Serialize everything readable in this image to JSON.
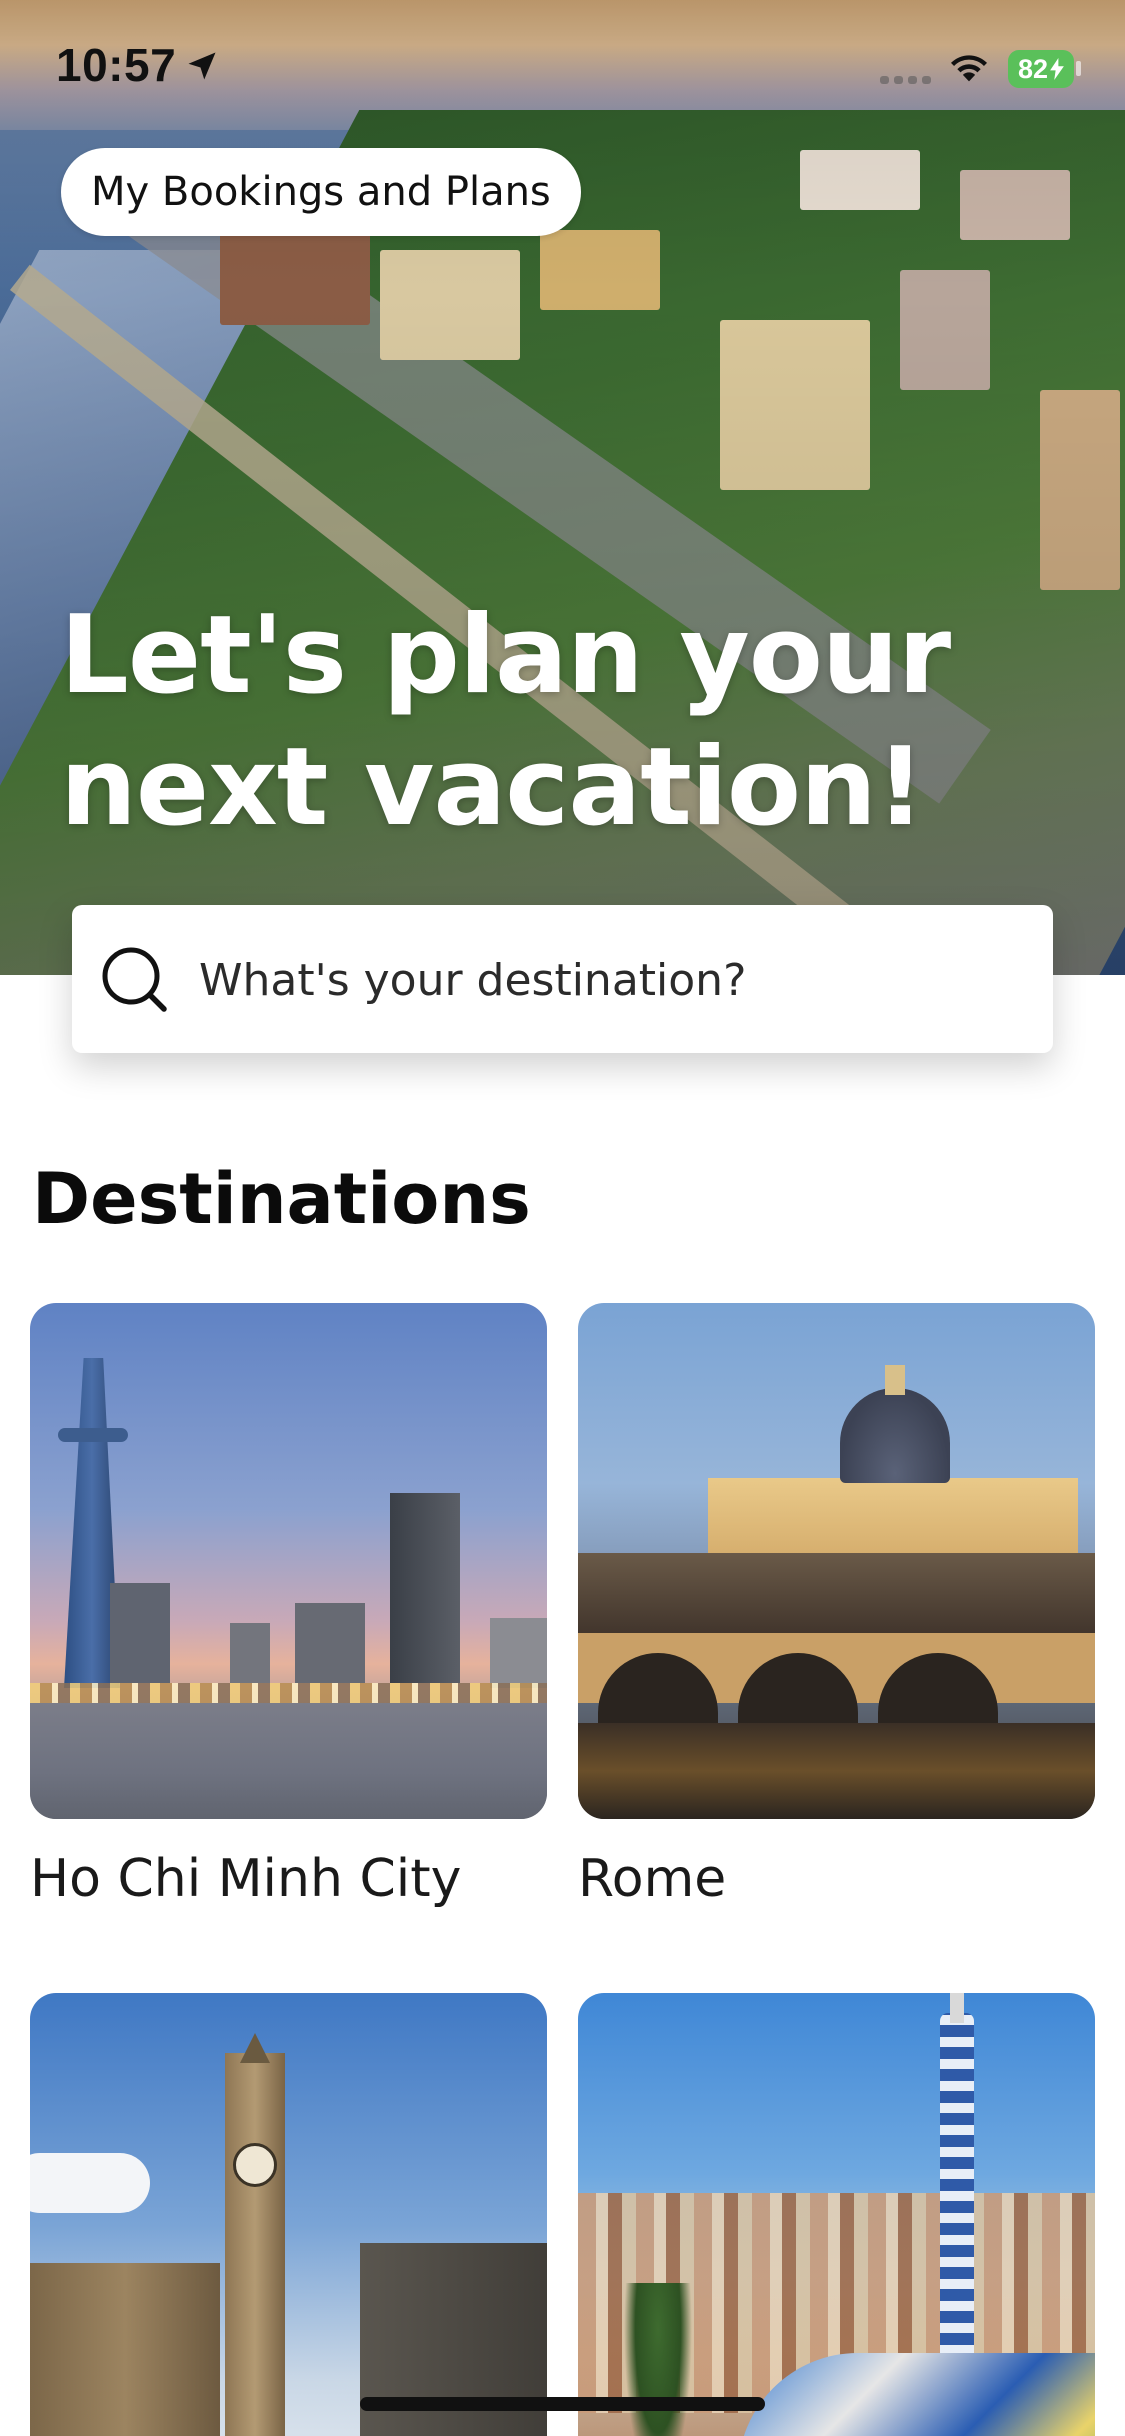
{
  "status_bar": {
    "time": "10:57",
    "battery": "82"
  },
  "header": {
    "bookings_label": "My Bookings and Plans",
    "hero_title_line1": "Let's plan your",
    "hero_title_line2": "next vacation!"
  },
  "search": {
    "placeholder": "What's your destination?"
  },
  "destinations": {
    "title": "Destinations",
    "items": [
      {
        "label": "Ho Chi Minh City"
      },
      {
        "label": "Rome"
      },
      {
        "label": ""
      },
      {
        "label": ""
      }
    ]
  },
  "colors": {
    "accent_battery": "#5ac05a",
    "text_primary": "#111111",
    "background": "#ffffff"
  },
  "icons": [
    "location-arrow-icon",
    "cellular-signal-icon",
    "wifi-icon",
    "battery-icon",
    "search-icon"
  ]
}
